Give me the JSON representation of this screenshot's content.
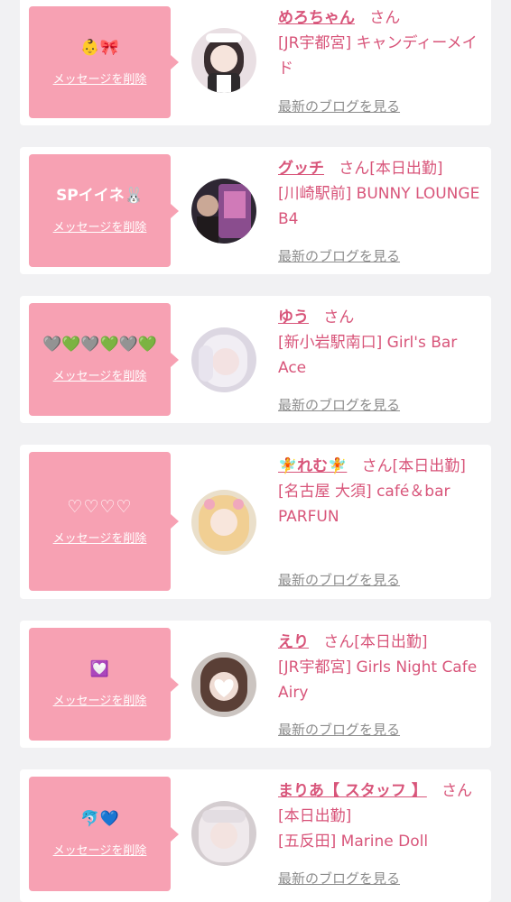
{
  "cards": [
    {
      "message": "👶🎀",
      "delete_label": "メッセージを削除",
      "name": "めろちゃん",
      "honorific": "さん",
      "shop": "[JR宇都宮] キャンディーメイド",
      "blog_label": "最新のブログを見る",
      "avatar_color": "#e9dfe3"
    },
    {
      "message": "SPイイネ🐰",
      "delete_label": "メッセージを削除",
      "name": "グッチ",
      "honorific": "さん[本日出勤]",
      "shop": "[川崎駅前] BUNNY LOUNGE B4",
      "blog_label": "最新のブログを見る",
      "avatar_color": "#5b3e5a"
    },
    {
      "message": "🩶💚🩶💚🩶💚",
      "delete_label": "メッセージを削除",
      "name": "ゆう",
      "honorific": "さん",
      "shop": "[新小岩駅南口] Girl's Bar Ace",
      "blog_label": "最新のブログを見る",
      "avatar_color": "#d9d3df"
    },
    {
      "message": "♡♡♡♡",
      "delete_label": "メッセージを削除",
      "name": "🧚れむ🧚",
      "honorific": "さん[本日出勤]",
      "shop": "[名古屋 大須] café＆bar PARFUN",
      "blog_label": "最新のブログを見る",
      "avatar_color": "#efd6b8"
    },
    {
      "message": "💟",
      "delete_label": "メッセージを削除",
      "name": "えり",
      "honorific": "さん[本日出勤]",
      "shop": "[JR宇都宮] Girls Night Cafe Airy",
      "blog_label": "最新のブログを見る",
      "avatar_color": "#cfc8c4"
    },
    {
      "message": "🐬💙",
      "delete_label": "メッセージを削除",
      "name": "まりあ【 スタッフ 】",
      "honorific": "さん[本日出勤]",
      "shop": "[五反田] Marine Doll",
      "blog_label": "最新のブログを見る",
      "avatar_color": "#d7d0d2"
    }
  ]
}
